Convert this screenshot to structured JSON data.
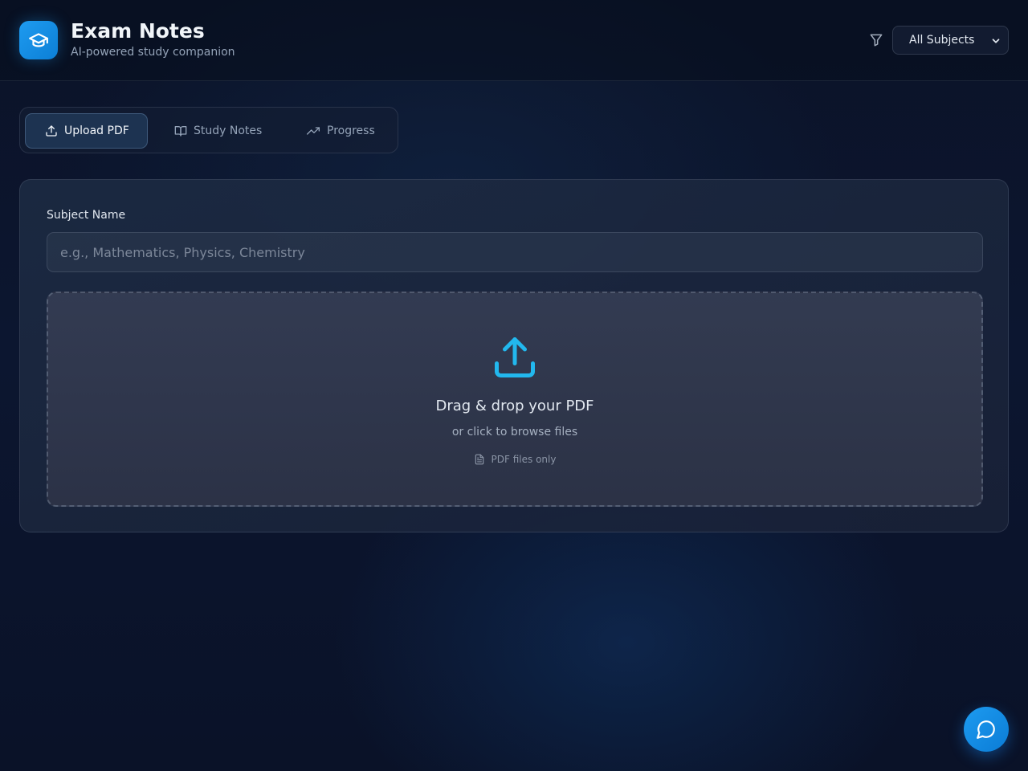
{
  "header": {
    "title": "Exam Notes",
    "subtitle": "AI-powered study companion",
    "logo_icon": "graduation-cap-icon",
    "filter_icon": "filter-icon",
    "subject_filter": {
      "selected": "All Subjects"
    }
  },
  "tabs": [
    {
      "label": "Upload PDF",
      "icon": "upload-icon",
      "active": true
    },
    {
      "label": "Study Notes",
      "icon": "book-open-icon",
      "active": false
    },
    {
      "label": "Progress",
      "icon": "trending-up-icon",
      "active": false
    }
  ],
  "upload_form": {
    "subject_label": "Subject Name",
    "subject_placeholder": "e.g., Mathematics, Physics, Chemistry",
    "subject_value": "",
    "dropzone": {
      "icon": "upload-icon",
      "title": "Drag & drop your PDF",
      "subtitle": "or click to browse files",
      "note_icon": "file-text-icon",
      "note": "PDF files only"
    }
  },
  "chat": {
    "icon": "message-circle-icon"
  },
  "colors": {
    "accent": "#1d9bf0",
    "upload_icon": "#22b8ee",
    "background": "#0c1630"
  }
}
